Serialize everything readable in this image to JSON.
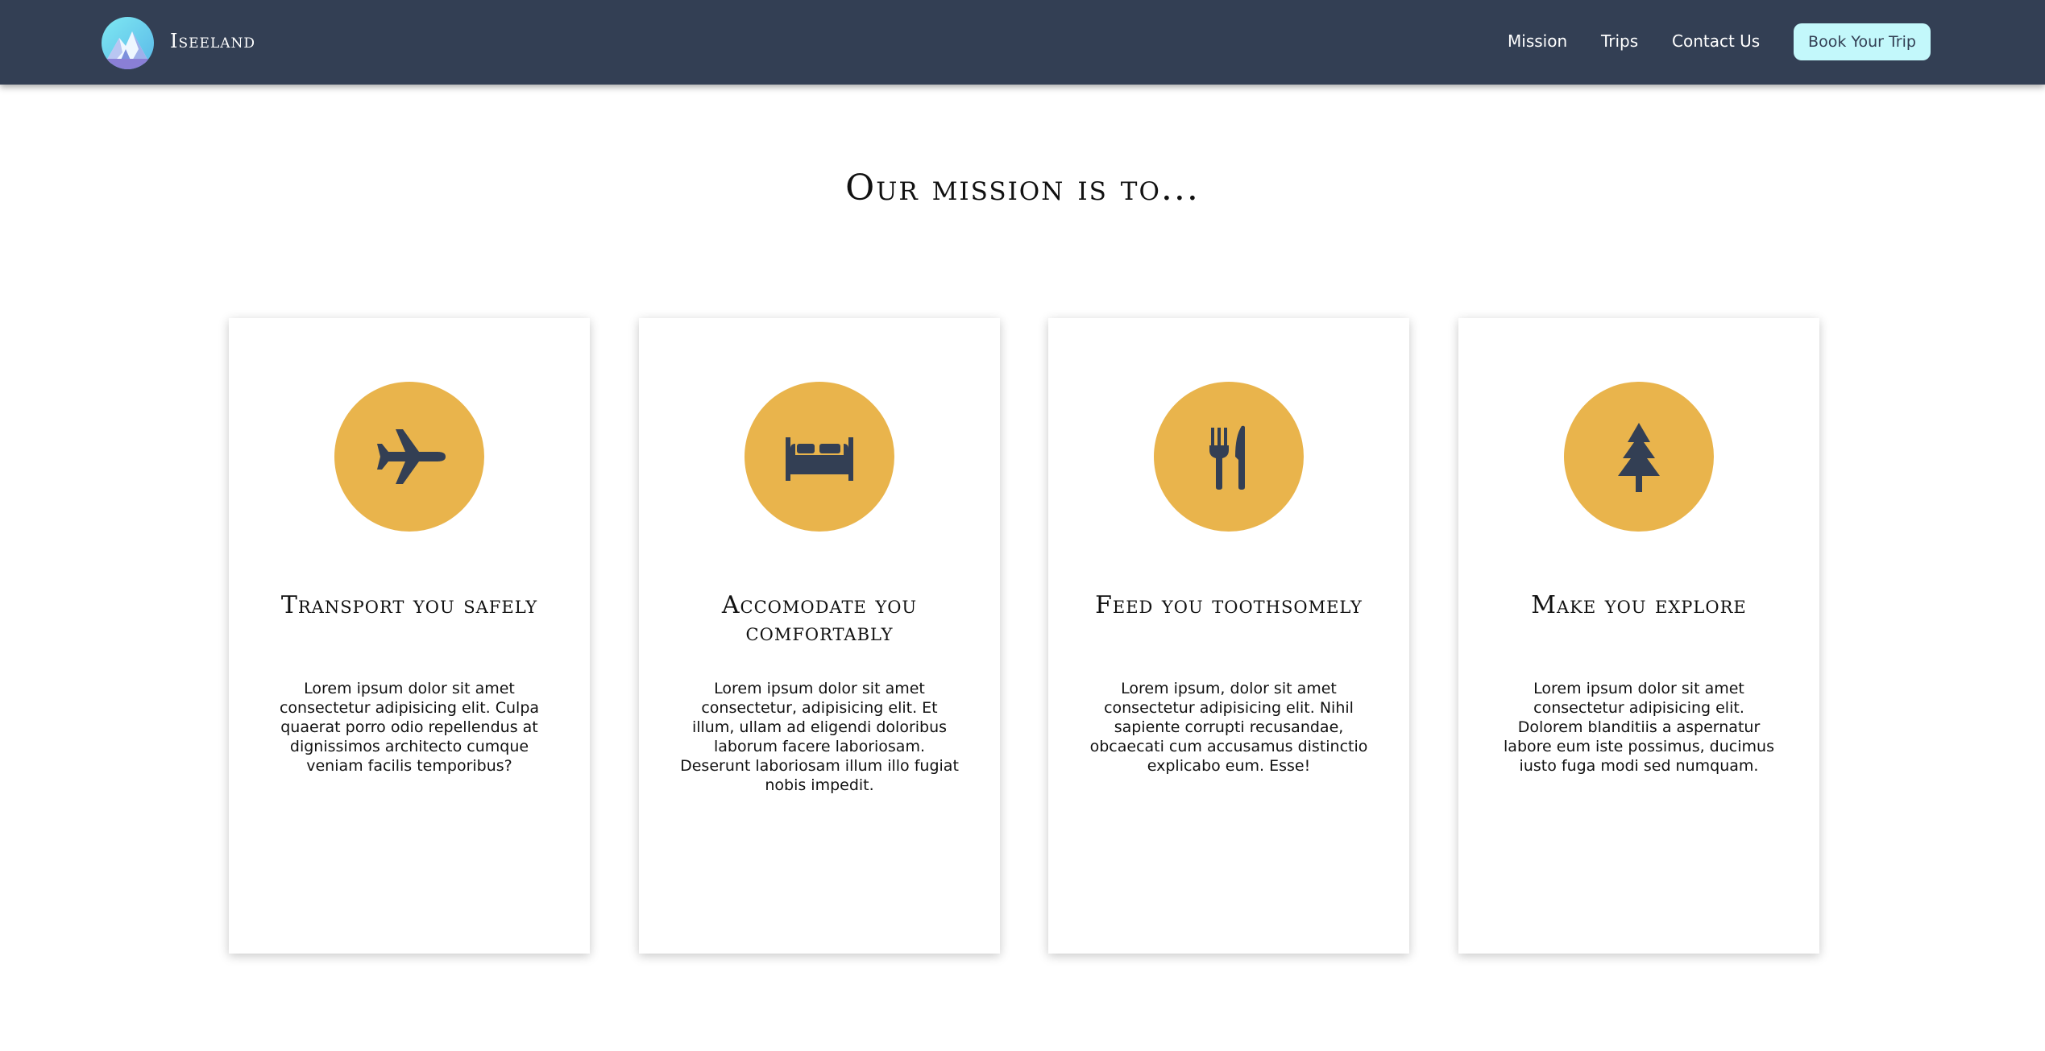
{
  "nav": {
    "brand": "Iseeland",
    "logo_icon": "mountain-logo-icon",
    "links": [
      "Mission",
      "Trips",
      "Contact Us"
    ],
    "cta": "Book Your Trip"
  },
  "mission": {
    "title": "Our mission is to...",
    "cards": [
      {
        "icon": "airplane-icon",
        "title": "Transport you safely",
        "text": "Lorem ipsum dolor sit amet consectetur adipisicing elit. Culpa quaerat porro odio repellendus at dignissimos architecto cumque veniam facilis temporibus?"
      },
      {
        "icon": "bed-icon",
        "title": "Accomodate you comfortably",
        "text": "Lorem ipsum dolor sit amet consectetur, adipisicing elit. Et illum, ullam ad eligendi doloribus laborum facere laboriosam. Deserunt laboriosam illum illo fugiat nobis impedit."
      },
      {
        "icon": "fork-knife-icon",
        "title": "Feed you toothsomely",
        "text": "Lorem ipsum, dolor sit amet consectetur adipisicing elit. Nihil sapiente corrupti recusandae, obcaecati cum accusamus distinctio explicabo eum. Esse!"
      },
      {
        "icon": "tree-icon",
        "title": "Make you explore",
        "text": "Lorem ipsum dolor sit amet consectetur adipisicing elit. Dolorem blanditiis a aspernatur labore eum iste possimus, ducimus iusto fuga modi sed numquam."
      }
    ]
  },
  "colors": {
    "navbar": "#333f54",
    "accent": "#e9b44c",
    "cta_background": "#c3f8fb",
    "icon": "#333f54"
  }
}
